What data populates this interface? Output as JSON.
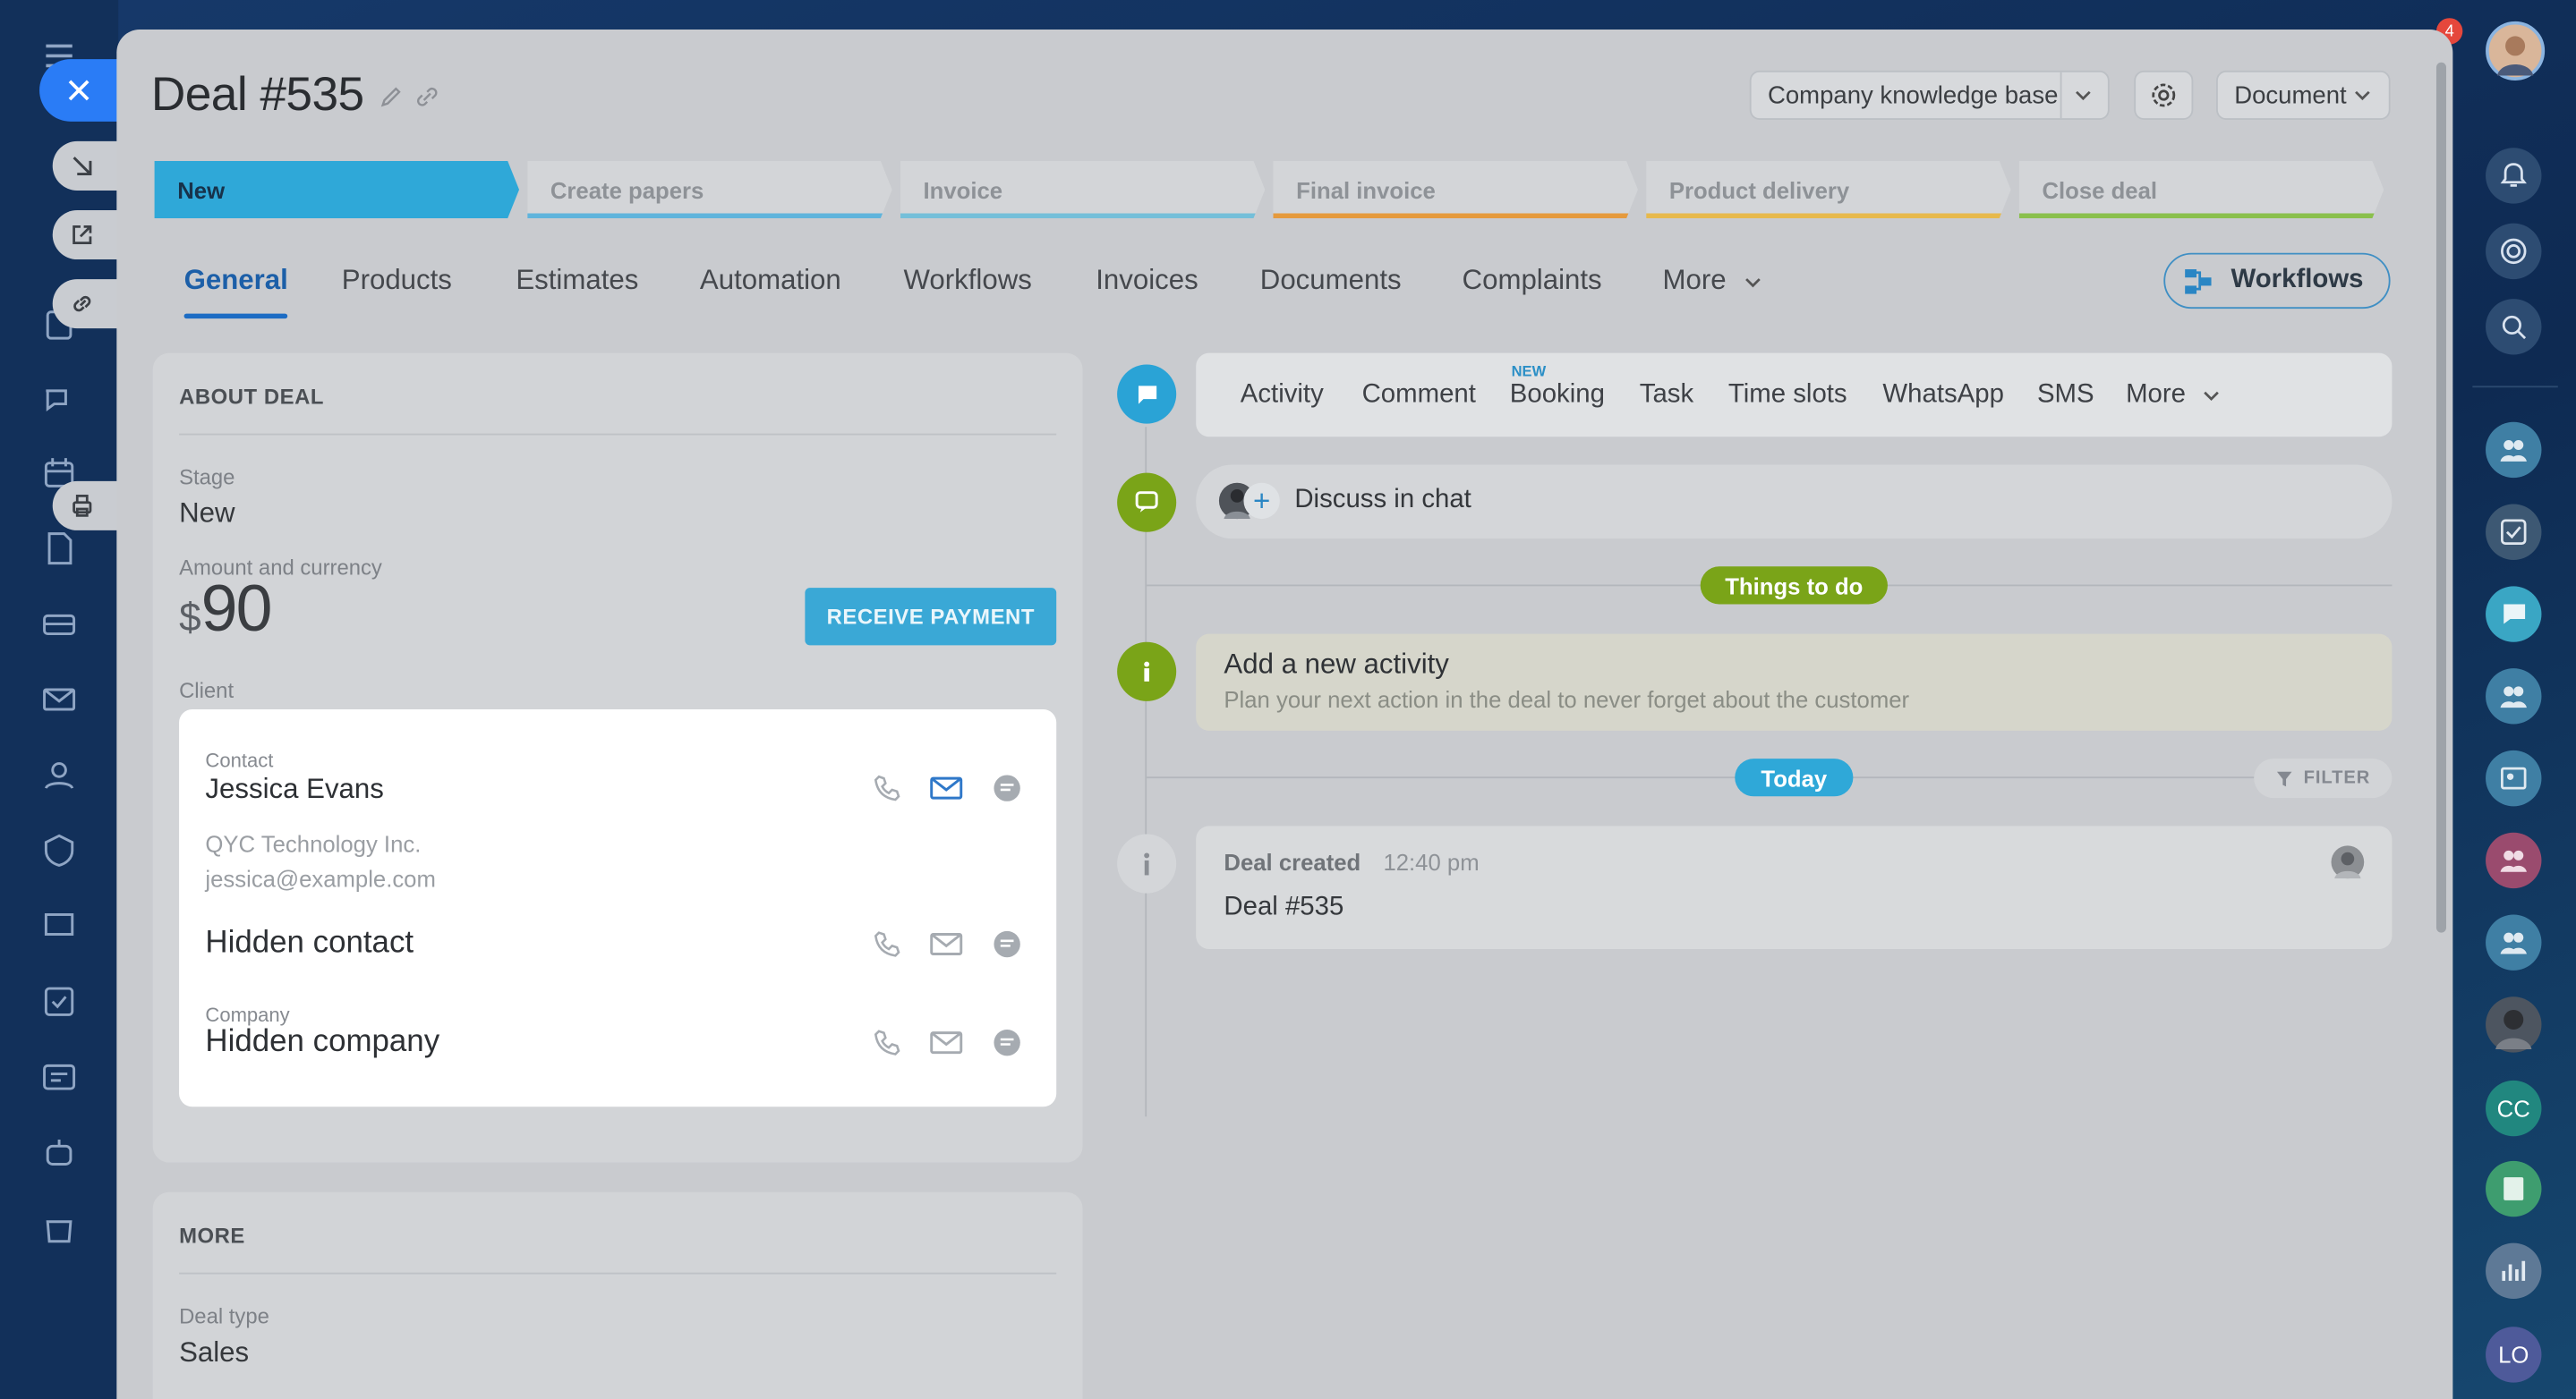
{
  "deal": {
    "title": "Deal #535"
  },
  "header": {
    "knowledge_base": "Company knowledge base",
    "document": "Document"
  },
  "stages": [
    {
      "label": "New",
      "color": "#2fa8d8"
    },
    {
      "label": "Create papers",
      "color": "#5fb4dc"
    },
    {
      "label": "Invoice",
      "color": "#74bfd9"
    },
    {
      "label": "Final invoice",
      "color": "#e59a3d"
    },
    {
      "label": "Product delivery",
      "color": "#e7b94c"
    },
    {
      "label": "Close deal",
      "color": "#8ac04c"
    }
  ],
  "tabs": [
    "General",
    "Products",
    "Estimates",
    "Automation",
    "Workflows",
    "Invoices",
    "Documents",
    "Complaints",
    "More"
  ],
  "workflows_button": "Workflows",
  "about": {
    "heading": "ABOUT DEAL",
    "stage_label": "Stage",
    "stage_value": "New",
    "amount_label": "Amount and currency",
    "currency": "$",
    "amount": "90",
    "receive_payment": "RECEIVE PAYMENT",
    "client_label": "Client",
    "contact_label": "Contact",
    "contact_name": "Jessica Evans",
    "contact_company": "QYC Technology Inc.",
    "contact_email": "jessica@example.com",
    "hidden_contact": "Hidden contact",
    "company_label": "Company",
    "hidden_company": "Hidden company"
  },
  "more_section": {
    "heading": "MORE",
    "deal_type_label": "Deal type",
    "deal_type_value": "Sales"
  },
  "composer_tabs": [
    "Activity",
    "Comment",
    "Booking",
    "Task",
    "Time slots",
    "WhatsApp",
    "SMS",
    "More"
  ],
  "new_badge": "NEW",
  "chat": {
    "discuss": "Discuss in chat"
  },
  "timeline": {
    "things_to_do": "Things to do",
    "add_activity_title": "Add a new activity",
    "add_activity_desc": "Plan your next action in the deal to never forget about the customer",
    "today": "Today",
    "filter": "FILTER",
    "event_title": "Deal created",
    "event_time": "12:40 pm",
    "event_body": "Deal #535"
  },
  "right_bar": {
    "notification_count": "4",
    "initials_1": "CC",
    "initials_2": "LO"
  },
  "colors": {
    "accent": "#2a7cf6",
    "tab_active": "#1c6cc4",
    "green": "#7aa418",
    "today": "#2fa8d8"
  }
}
